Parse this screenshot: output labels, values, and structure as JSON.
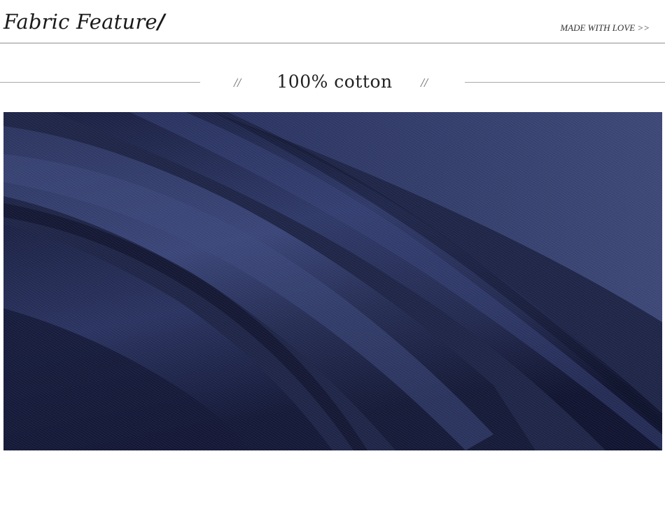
{
  "header": {
    "title": "Fabric Feature",
    "title_mark": "/",
    "tagline": "MADE WITH LOVE >>"
  },
  "section": {
    "slash_left": "//",
    "subtitle": "100% cotton",
    "slash_right": "//"
  },
  "photo": {
    "subject": "navy knit fabric folds",
    "base_color": "#1e2547",
    "highlight_color": "#3a4578",
    "shadow_color": "#0e1128"
  }
}
